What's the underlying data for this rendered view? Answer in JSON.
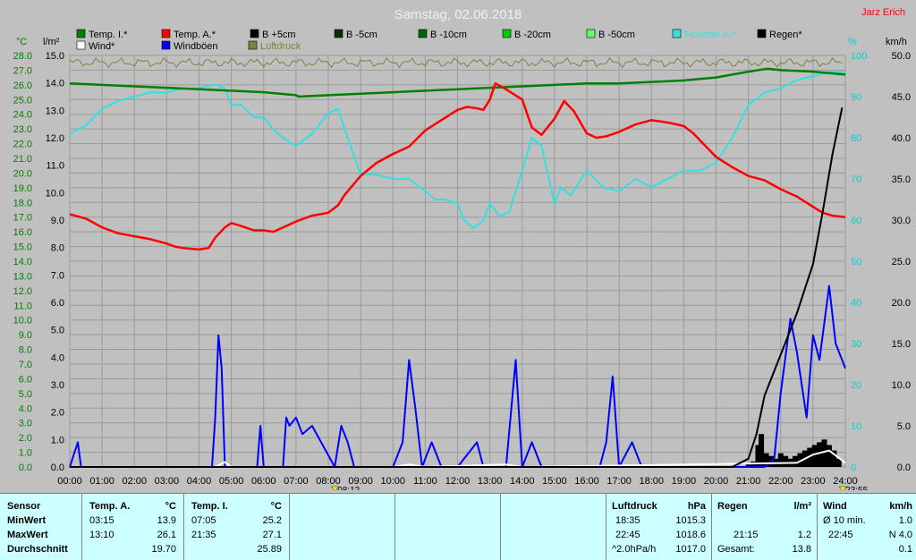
{
  "colors": {
    "background": "#c0c0c0",
    "plot_background": "#c0c0c0",
    "temp_inside": "#008000",
    "temp_outside": "#ff0000",
    "humidity": "#33e0e0",
    "wind_gust": "#0000ff",
    "wind": "#ffffff",
    "pressure": "#808040",
    "rain": "#000000",
    "stats_background": "#ccffff"
  },
  "header": {
    "title": "Samstag, 02.06.2018",
    "author": "Jarz Erich"
  },
  "axes": {
    "left1_unit": "°C",
    "left2_unit": "l/m²",
    "right1_unit": "%",
    "right2_unit": "km/h",
    "left1_ticks": [
      "28.0",
      "27.0",
      "26.0",
      "25.0",
      "24.0",
      "23.0",
      "22.0",
      "21.0",
      "20.0",
      "19.0",
      "18.0",
      "17.0",
      "16.0",
      "15.0",
      "14.0",
      "13.0",
      "12.0",
      "11.0",
      "10.0",
      "9.0",
      "8.0",
      "7.0",
      "6.0",
      "5.0",
      "4.0",
      "3.0",
      "2.0",
      "1.0",
      "0.0"
    ],
    "left2_ticks": [
      "15.0",
      "14.0",
      "13.0",
      "12.0",
      "11.0",
      "10.0",
      "9.0",
      "8.0",
      "7.0",
      "6.0",
      "5.0",
      "4.0",
      "3.0",
      "2.0",
      "1.0",
      "0.0"
    ],
    "right1_ticks": [
      "100",
      "90",
      "80",
      "70",
      "60",
      "50",
      "40",
      "30",
      "20",
      "10",
      "0"
    ],
    "right2_ticks": [
      "50.0",
      "45.0",
      "40.0",
      "35.0",
      "30.0",
      "25.0",
      "20.0",
      "15.0",
      "10.0",
      "5.0",
      "0.0"
    ],
    "x_ticks": [
      "00:00",
      "01:00",
      "02:00",
      "03:00",
      "04:00",
      "05:00",
      "06:00",
      "07:00",
      "08:00",
      "09:00",
      "10:00",
      "11:00",
      "12:00",
      "13:00",
      "14:00",
      "15:00",
      "16:00",
      "17:00",
      "18:00",
      "19:00",
      "20:00",
      "21:00",
      "22:00",
      "23:00",
      "24:00"
    ],
    "sunrise_label": "08:12",
    "sunset_label": "23:55"
  },
  "legend": [
    {
      "label": "Temp. I.*",
      "color": "#008000"
    },
    {
      "label": "Temp. A.*",
      "color": "#ff0000"
    },
    {
      "label": "B +5cm",
      "color": "#000000"
    },
    {
      "label": "B -5cm",
      "color": "#003300"
    },
    {
      "label": "B -10cm",
      "color": "#006600"
    },
    {
      "label": "B -20cm",
      "color": "#00cc00"
    },
    {
      "label": "B -50cm",
      "color": "#66ff66"
    },
    {
      "label": "Feuchte A.*",
      "color": "#33e0e0"
    },
    {
      "label": "Regen*",
      "color": "#000000"
    },
    {
      "label": "Wind*",
      "color": "#ffffff"
    },
    {
      "label": "Windböen",
      "color": "#0000ff"
    },
    {
      "label": "Luftdruck",
      "color": "#808040"
    }
  ],
  "chart_data": {
    "type": "line",
    "title": "Samstag, 02.06.2018",
    "x_unit": "hour of day",
    "x_range": [
      0,
      24
    ],
    "series": [
      {
        "name": "Temp. A.*",
        "axis": "°C",
        "ylim": [
          0,
          28
        ],
        "x": [
          0,
          0.5,
          1,
          1.5,
          2,
          2.5,
          3,
          3.25,
          3.5,
          4,
          4.3,
          4.5,
          4.8,
          5,
          5.3,
          5.7,
          6,
          6.3,
          6.5,
          7,
          7.5,
          8,
          8.3,
          8.5,
          9,
          9.5,
          10,
          10.5,
          11,
          11.5,
          12,
          12.3,
          12.6,
          12.8,
          13,
          13.17,
          13.5,
          14,
          14.3,
          14.6,
          15,
          15.3,
          15.6,
          16,
          16.3,
          16.6,
          17,
          17.5,
          18,
          18.3,
          18.6,
          19,
          19.3,
          19.6,
          20,
          20.5,
          21,
          21.5,
          22,
          22.5,
          23,
          23.3,
          23.6,
          24
        ],
        "y": [
          17.2,
          16.9,
          16.3,
          15.9,
          15.7,
          15.5,
          15.2,
          15.0,
          14.9,
          14.8,
          14.9,
          15.6,
          16.3,
          16.6,
          16.4,
          16.1,
          16.1,
          16.0,
          16.2,
          16.7,
          17.1,
          17.3,
          17.8,
          18.5,
          19.8,
          20.7,
          21.3,
          21.8,
          22.9,
          23.6,
          24.3,
          24.5,
          24.4,
          24.3,
          25.0,
          26.1,
          25.7,
          25.0,
          23.1,
          22.6,
          23.7,
          24.9,
          24.2,
          22.7,
          22.4,
          22.5,
          22.8,
          23.3,
          23.6,
          23.5,
          23.4,
          23.2,
          22.7,
          22.0,
          21.1,
          20.4,
          19.8,
          19.5,
          18.9,
          18.4,
          17.7,
          17.3,
          17.1,
          17.0
        ]
      },
      {
        "name": "Temp. I.*",
        "axis": "°C",
        "ylim": [
          0,
          28
        ],
        "x": [
          0,
          1,
          2,
          3,
          4,
          5,
          6,
          7,
          7.08,
          8,
          9,
          10,
          11,
          12,
          13,
          14,
          15,
          16,
          17,
          18,
          19,
          20,
          21,
          21.58,
          22,
          23,
          24
        ],
        "y": [
          26.1,
          26.0,
          25.9,
          25.8,
          25.7,
          25.6,
          25.5,
          25.3,
          25.2,
          25.3,
          25.4,
          25.5,
          25.6,
          25.7,
          25.8,
          25.9,
          26.0,
          26.1,
          26.1,
          26.2,
          26.3,
          26.5,
          26.9,
          27.1,
          27.0,
          26.9,
          26.7
        ]
      },
      {
        "name": "Feuchte A.*",
        "axis": "%",
        "ylim": [
          0,
          100
        ],
        "x": [
          0,
          0.5,
          1,
          1.5,
          2,
          2.5,
          3,
          3.5,
          4,
          4.5,
          4.8,
          5,
          5.3,
          5.7,
          6,
          6.3,
          6.6,
          7,
          7.5,
          8,
          8.3,
          8.6,
          9,
          9.5,
          10,
          10.5,
          11,
          11.3,
          11.6,
          12,
          12.2,
          12.5,
          12.8,
          13,
          13.3,
          13.6,
          14,
          14.3,
          14.6,
          15,
          15.2,
          15.5,
          16,
          16.5,
          17,
          17.5,
          18,
          18.5,
          19,
          19.5,
          20,
          20.5,
          21,
          21.5,
          22,
          22.5,
          23,
          23.5,
          24
        ],
        "y": [
          81,
          83,
          87,
          89,
          90,
          91,
          91,
          92,
          92,
          93,
          92,
          88,
          88,
          85,
          85,
          82,
          80,
          78,
          81,
          86,
          87,
          80,
          71,
          71,
          70,
          70,
          67,
          65,
          65,
          64,
          60,
          58,
          60,
          64,
          61,
          62,
          72,
          80,
          78,
          64,
          68,
          66,
          72,
          68,
          67,
          70,
          68,
          70,
          72,
          72,
          74,
          80,
          88,
          91,
          92,
          94,
          95,
          96,
          96
        ]
      },
      {
        "name": "Windböen",
        "axis": "km/h",
        "ylim": [
          0,
          50
        ],
        "x": [
          0,
          0.25,
          0.35,
          0.45,
          4.4,
          4.5,
          4.6,
          4.7,
          4.8,
          5.0,
          5.8,
          5.9,
          6.0,
          6.6,
          6.7,
          6.8,
          7.0,
          7.2,
          7.5,
          8.2,
          8.4,
          8.6,
          8.8,
          10.0,
          10.3,
          10.5,
          10.7,
          10.9,
          11.2,
          11.5,
          12.0,
          12.6,
          12.8,
          13.0,
          13.5,
          13.8,
          14.0,
          14.3,
          14.6,
          16.4,
          16.6,
          16.8,
          17.0,
          17.4,
          17.7,
          21.5,
          21.8,
          22.0,
          22.3,
          22.5,
          22.8,
          23.0,
          23.2,
          23.5,
          23.7,
          24
        ],
        "y": [
          0,
          3,
          0,
          0,
          0,
          6,
          16,
          12,
          0,
          0,
          0,
          5,
          0,
          0,
          6,
          5,
          6,
          4,
          5,
          0,
          5,
          3,
          0,
          0,
          3,
          13,
          7,
          0,
          3,
          0,
          0,
          3,
          0,
          0,
          0,
          13,
          0,
          3,
          0,
          0,
          3,
          11,
          0,
          3,
          0,
          0,
          1,
          9,
          18,
          14,
          6,
          16,
          13,
          22,
          15,
          12
        ]
      },
      {
        "name": "Wind*",
        "axis": "km/h",
        "ylim": [
          0,
          50
        ],
        "x": [
          0,
          4.5,
          4.8,
          5,
          10,
          10.5,
          11,
          13.5,
          14,
          22.5,
          23,
          23.5,
          24
        ],
        "y": [
          0,
          0,
          0.6,
          0,
          0,
          0.3,
          0,
          0.3,
          0,
          0.5,
          1.5,
          2.0,
          0.5
        ]
      },
      {
        "name": "Regen*",
        "axis": "l/m²",
        "ylim": [
          0,
          15
        ],
        "x": [
          0,
          20.5,
          21,
          21.25,
          21.5,
          22,
          22.5,
          23,
          23.3,
          23.6,
          23.9
        ],
        "y": [
          0,
          0,
          0.3,
          1.2,
          2.6,
          4.1,
          5.6,
          7.4,
          9.3,
          11.4,
          13.1
        ]
      },
      {
        "name": "Luftdruck",
        "axis": "hPa",
        "ylim": [
          1000,
          1020
        ],
        "x": [
          0,
          3,
          6,
          9,
          12,
          15,
          18.58,
          21,
          22.75,
          24
        ],
        "y": [
          1017.5,
          1017.3,
          1017.0,
          1016.5,
          1016.0,
          1015.6,
          1015.3,
          1016.5,
          1018.6,
          1017.5
        ]
      }
    ],
    "rain_bars": {
      "name": "Regen (10 min)",
      "axis": "l/m²",
      "x": [
        21.0,
        21.15,
        21.3,
        21.4,
        21.55,
        21.7,
        21.85,
        22.0,
        22.15,
        22.3,
        22.45,
        22.6,
        22.75,
        22.9,
        23.05,
        23.2,
        23.35,
        23.5,
        23.65,
        23.8
      ],
      "y": [
        0.1,
        0.2,
        0.8,
        1.2,
        0.5,
        0.4,
        0.3,
        0.5,
        0.4,
        0.3,
        0.4,
        0.5,
        0.6,
        0.7,
        0.8,
        0.9,
        1.0,
        0.8,
        0.6,
        0.3
      ]
    }
  },
  "stats": {
    "sensor": {
      "header": "Sensor",
      "min": "MinWert",
      "max": "MaxWert",
      "avg": "Durchschnitt"
    },
    "temp_a": {
      "header": "Temp. A.",
      "unit": "°C",
      "min_time": "03:15",
      "min_val": "13.9",
      "max_time": "13:10",
      "max_val": "26.1",
      "avg": "19.70"
    },
    "temp_i": {
      "header": "Temp. I.",
      "unit": "°C",
      "min_time": "07:05",
      "min_val": "25.2",
      "max_time": "21:35",
      "max_val": "27.1",
      "avg": "25.89"
    },
    "pressure": {
      "header": "Luftdruck",
      "unit": "hPa",
      "min_time": "18:35",
      "min_val": "1015.3",
      "max_time": "22:45",
      "max_val": "1018.6",
      "trend_label": "^2.0hPa/h",
      "trend_val": "1017.0"
    },
    "rain": {
      "header": "Regen",
      "unit": "l/m²",
      "max_time": "21:15",
      "max_val": "1.2",
      "total_label": "Gesamt:",
      "total_val": "13.8"
    },
    "wind": {
      "header": "Wind",
      "unit": "km/h",
      "min_label": "Ø 10 min.",
      "min_val": "1.0",
      "max_time": "22:45",
      "max_val": "N 4.0",
      "avg": "0.1"
    }
  }
}
